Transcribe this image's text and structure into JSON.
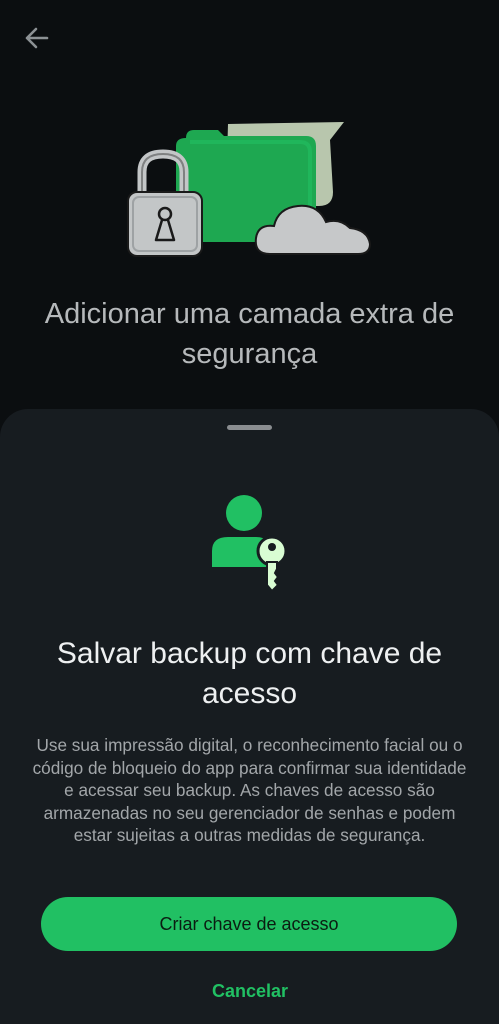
{
  "header": {
    "back_icon": "arrow-left-icon"
  },
  "hero": {
    "illustration": "folder-lock-cloud-illustration",
    "title": "Adicionar uma camada extra de segurança"
  },
  "sheet": {
    "icon": "person-key-icon",
    "title": "Salvar backup com chave de acesso",
    "body": "Use sua impressão digital, o reconhecimento facial ou o código de bloqueio do app para confirmar sua identidade e acessar seu backup. As chaves de acesso são armazenadas no seu gerenciador de senhas e podem estar sujeitas a outras medidas de segurança.",
    "primary_button": "Criar chave de acesso",
    "cancel_button": "Cancelar"
  },
  "colors": {
    "background": "#0b0e10",
    "sheet": "#171c20",
    "accent": "#21c063",
    "key_light": "#d9fdd3"
  }
}
